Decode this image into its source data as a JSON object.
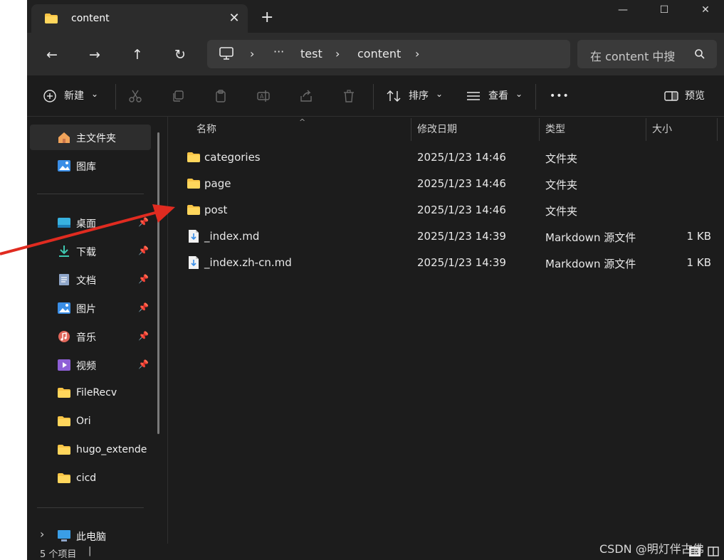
{
  "tab": {
    "title": "content",
    "close": "✕",
    "new_tab": "+"
  },
  "window_controls": {
    "minimize": "—",
    "maximize": "☐",
    "close": "✕"
  },
  "nav": {
    "back": "←",
    "forward": "→",
    "up": "↑",
    "refresh": "↻"
  },
  "breadcrumb": {
    "sep1": "›",
    "more": "···",
    "seg1": "test",
    "sep2": "›",
    "seg2": "content",
    "sep3": "›"
  },
  "search": {
    "placeholder": "在 content 中搜"
  },
  "toolbar": {
    "new_label": "新建",
    "new_chevron": "⌄",
    "sort_label": "排序",
    "sort_chevron": "⌄",
    "view_label": "查看",
    "view_chevron": "⌄",
    "more": "•••",
    "preview_label": "预览"
  },
  "sidebar": {
    "items": [
      {
        "label": "主文件夹"
      },
      {
        "label": "图库"
      },
      {
        "label": "桌面",
        "pinned": true
      },
      {
        "label": "下载",
        "pinned": true
      },
      {
        "label": "文档",
        "pinned": true
      },
      {
        "label": "图片",
        "pinned": true
      },
      {
        "label": "音乐",
        "pinned": true
      },
      {
        "label": "视频",
        "pinned": true
      },
      {
        "label": "FileRecv"
      },
      {
        "label": "Ori"
      },
      {
        "label": "hugo_extende"
      },
      {
        "label": "cicd"
      },
      {
        "label": "此电脑"
      }
    ],
    "pin_glyph": "📌",
    "expand_glyph": "›"
  },
  "columns": {
    "name": "名称",
    "modified": "修改日期",
    "type": "类型",
    "size": "大小",
    "sort_indicator": "^"
  },
  "files": [
    {
      "name": "categories",
      "modified": "2025/1/23 14:46",
      "type": "文件夹",
      "size": "",
      "icon": "folder-icon"
    },
    {
      "name": "page",
      "modified": "2025/1/23 14:46",
      "type": "文件夹",
      "size": "",
      "icon": "folder-icon"
    },
    {
      "name": "post",
      "modified": "2025/1/23 14:46",
      "type": "文件夹",
      "size": "",
      "icon": "folder-icon"
    },
    {
      "name": "_index.md",
      "modified": "2025/1/23 14:39",
      "type": "Markdown 源文件",
      "size": "1 KB",
      "icon": "markdown-file-icon"
    },
    {
      "name": "_index.zh-cn.md",
      "modified": "2025/1/23 14:39",
      "type": "Markdown 源文件",
      "size": "1 KB",
      "icon": "markdown-file-icon"
    }
  ],
  "status": {
    "count": "5 个项目",
    "sep": "|"
  },
  "watermark": "CSDN @明灯伴古佛",
  "colors": {
    "folder": "#f8c446",
    "annotation_arrow": "#e02b20",
    "selected_bg": "#2d2d2d"
  }
}
